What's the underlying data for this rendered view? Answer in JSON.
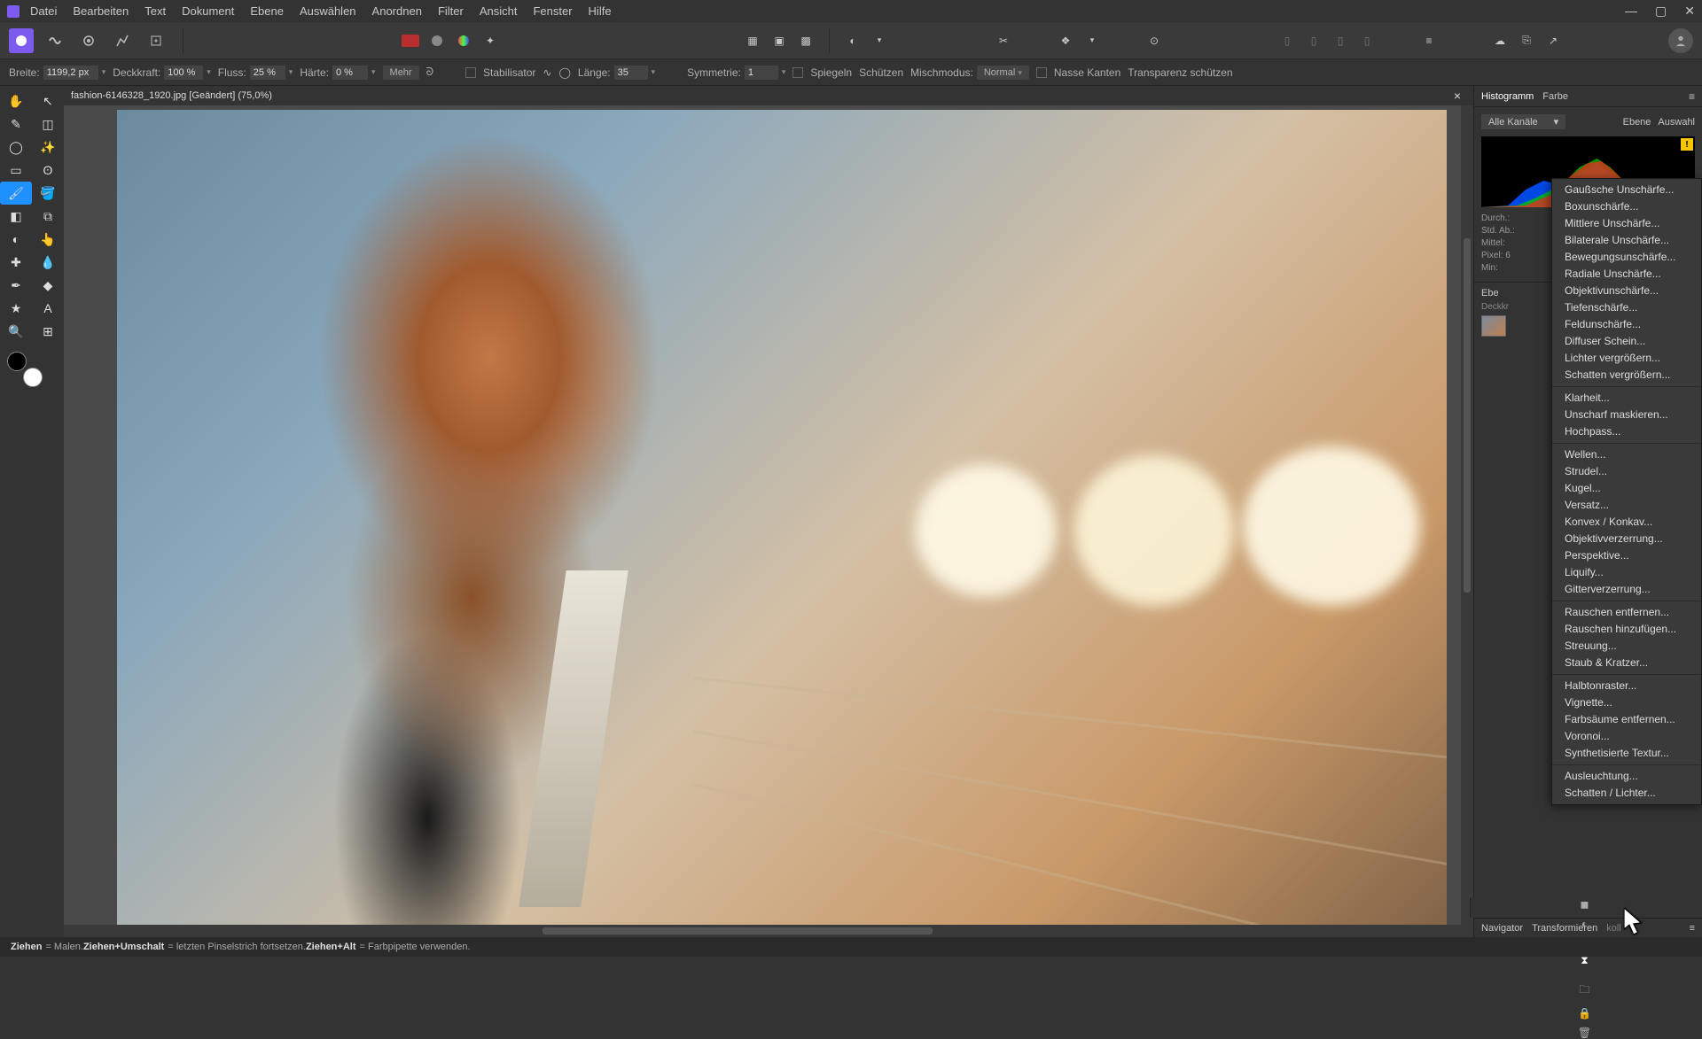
{
  "menu": [
    "Datei",
    "Bearbeiten",
    "Text",
    "Dokument",
    "Ebene",
    "Auswählen",
    "Anordnen",
    "Filter",
    "Ansicht",
    "Fenster",
    "Hilfe"
  ],
  "context_toolbar": {
    "breite_label": "Breite:",
    "breite_value": "1199,2 px",
    "deckkraft_label": "Deckkraft:",
    "deckkraft_value": "100 %",
    "fluss_label": "Fluss:",
    "fluss_value": "25 %",
    "haerte_label": "Härte:",
    "haerte_value": "0 %",
    "mehr": "Mehr",
    "stabilisator": "Stabilisator",
    "laenge_label": "Länge:",
    "laenge_value": "35",
    "symmetrie_label": "Symmetrie:",
    "symmetrie_value": "1",
    "spiegeln": "Spiegeln",
    "schuetzen": "Schützen",
    "mischmodus_label": "Mischmodus:",
    "mischmodus_value": "Normal",
    "nasse_kanten": "Nasse Kanten",
    "transparenz": "Transparenz schützen"
  },
  "doc_tab": "fashion-6146328_1920.jpg [Geändert] (75,0%)",
  "histogram": {
    "tab1": "Histogramm",
    "tab2": "Farbe",
    "channels": "Alle Kanäle",
    "ebene": "Ebene",
    "auswahl": "Auswahl",
    "stat1": "Durch.:",
    "stat2": "Std. Ab.:",
    "stat3": "Mittel:",
    "stat4": "Pixel: 6",
    "stat5": "Min:",
    "warn": "!"
  },
  "layer": {
    "tab": "Ebe",
    "deckkr": "Deckkr"
  },
  "filter_menu": {
    "g1": [
      "Gaußsche Unschärfe...",
      "Boxunschärfe...",
      "Mittlere Unschärfe...",
      "Bilaterale Unschärfe...",
      "Bewegungsunschärfe...",
      "Radiale Unschärfe...",
      "Objektivunschärfe...",
      "Tiefenschärfe...",
      "Feldunschärfe...",
      "Diffuser Schein...",
      "Lichter vergrößern...",
      "Schatten vergrößern..."
    ],
    "g2": [
      "Klarheit...",
      "Unscharf maskieren...",
      "Hochpass..."
    ],
    "g3": [
      "Wellen...",
      "Strudel...",
      "Kugel...",
      "Versatz...",
      "Konvex / Konkav...",
      "Objektivverzerrung...",
      "Perspektive...",
      "Liquify...",
      "Gitterverzerrung..."
    ],
    "g4": [
      "Rauschen entfernen...",
      "Rauschen hinzufügen...",
      "Streuung...",
      "Staub & Kratzer..."
    ],
    "g5": [
      "Halbtonraster...",
      "Vignette...",
      "Farbsäume entfernen...",
      "Voronoi...",
      "Synthetisierte Textur..."
    ],
    "g6": [
      "Ausleuchtung...",
      "Schatten / Lichter..."
    ]
  },
  "bottom_tabs": {
    "nav": "Navigator",
    "trans": "Transformieren",
    "prot": "koll"
  },
  "status": {
    "s1a": "Ziehen",
    "s1b": " = Malen. ",
    "s2a": "Ziehen+Umschalt",
    "s2b": " = letzten Pinselstrich fortsetzen. ",
    "s3a": "Ziehen+Alt",
    "s3b": " = Farbpipette verwenden."
  }
}
